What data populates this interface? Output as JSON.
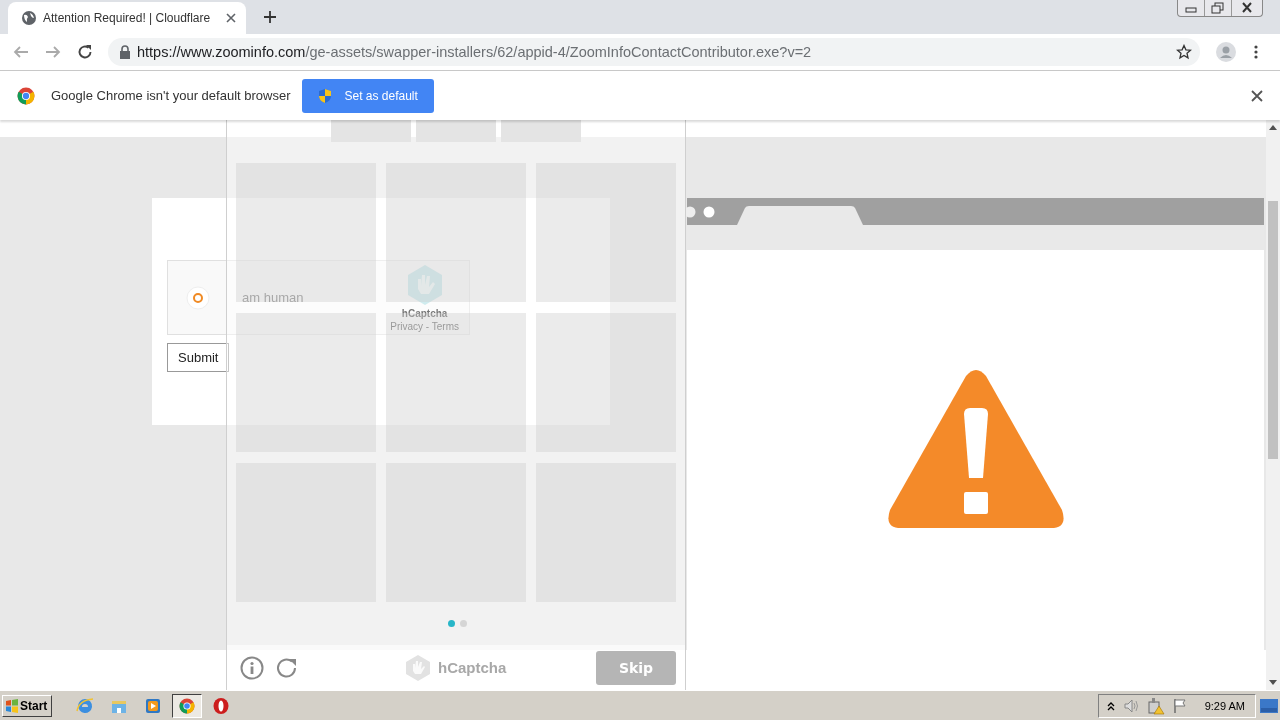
{
  "browser_tab": {
    "title": "Attention Required! | Cloudflare",
    "selected": true
  },
  "address_bar": {
    "origin": "https://www.zoominfo.com",
    "path": "/ge-assets/swapper-installers/62/appid-4/ZoomInfoContactContributor.exe?v=2"
  },
  "infobar": {
    "message": "Google Chrome isn't your default browser",
    "button": "Set as default"
  },
  "page": {
    "checkbox_label": "am human",
    "submit": "Submit",
    "widget_brand": "hCaptcha",
    "widget_links": "Privacy - Terms"
  },
  "challenge": {
    "pager": [
      {
        "selected": true
      },
      {
        "selected": false
      }
    ],
    "brand": "hCaptcha",
    "skip": "Skip"
  },
  "taskbar": {
    "start": "Start",
    "apps": [
      {
        "kind": "ie",
        "selected": false
      },
      {
        "kind": "explorer",
        "selected": false
      },
      {
        "kind": "media",
        "selected": false
      },
      {
        "kind": "chrome",
        "selected": true
      },
      {
        "kind": "opera",
        "selected": false
      }
    ],
    "clock": "9:29 AM"
  }
}
